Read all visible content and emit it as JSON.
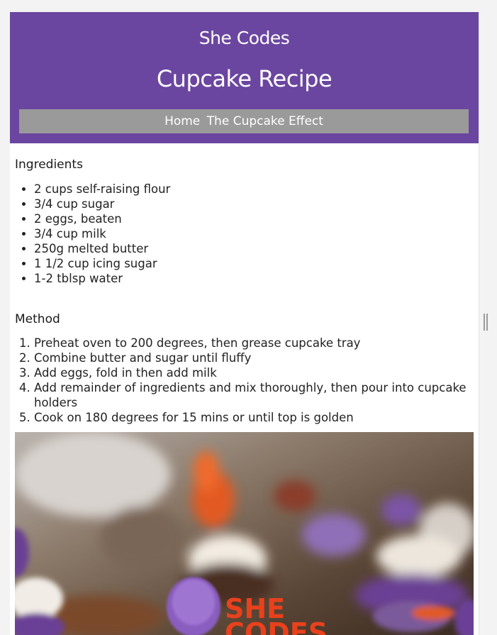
{
  "header": {
    "brand": "She Codes",
    "title": "Cupcake Recipe"
  },
  "nav": {
    "items": [
      {
        "label": "Home"
      },
      {
        "label": "The Cupcake Effect"
      }
    ]
  },
  "ingredients": {
    "heading": "Ingredients",
    "items": [
      "2 cups self-raising flour",
      "3/4 cup sugar",
      "2 eggs, beaten",
      "3/4 cup milk",
      "250g melted butter",
      "1 1/2 cup icing sugar",
      "1-2 tblsp water"
    ]
  },
  "method": {
    "heading": "Method",
    "steps": [
      "Preheat oven to 200 degrees, then grease cupcake tray",
      "Combine butter and sugar until fluffy",
      "Add eggs, fold in then add milk",
      "Add remainder of ingredients and mix thoroughly, then pour into cupcake holders",
      "Cook on 180 degrees for 15 mins or until top is golden"
    ]
  },
  "photo": {
    "topper_text": "SHE CODES"
  },
  "colors": {
    "header_bg": "#6b46a0",
    "nav_bg": "#9a9a9a"
  }
}
